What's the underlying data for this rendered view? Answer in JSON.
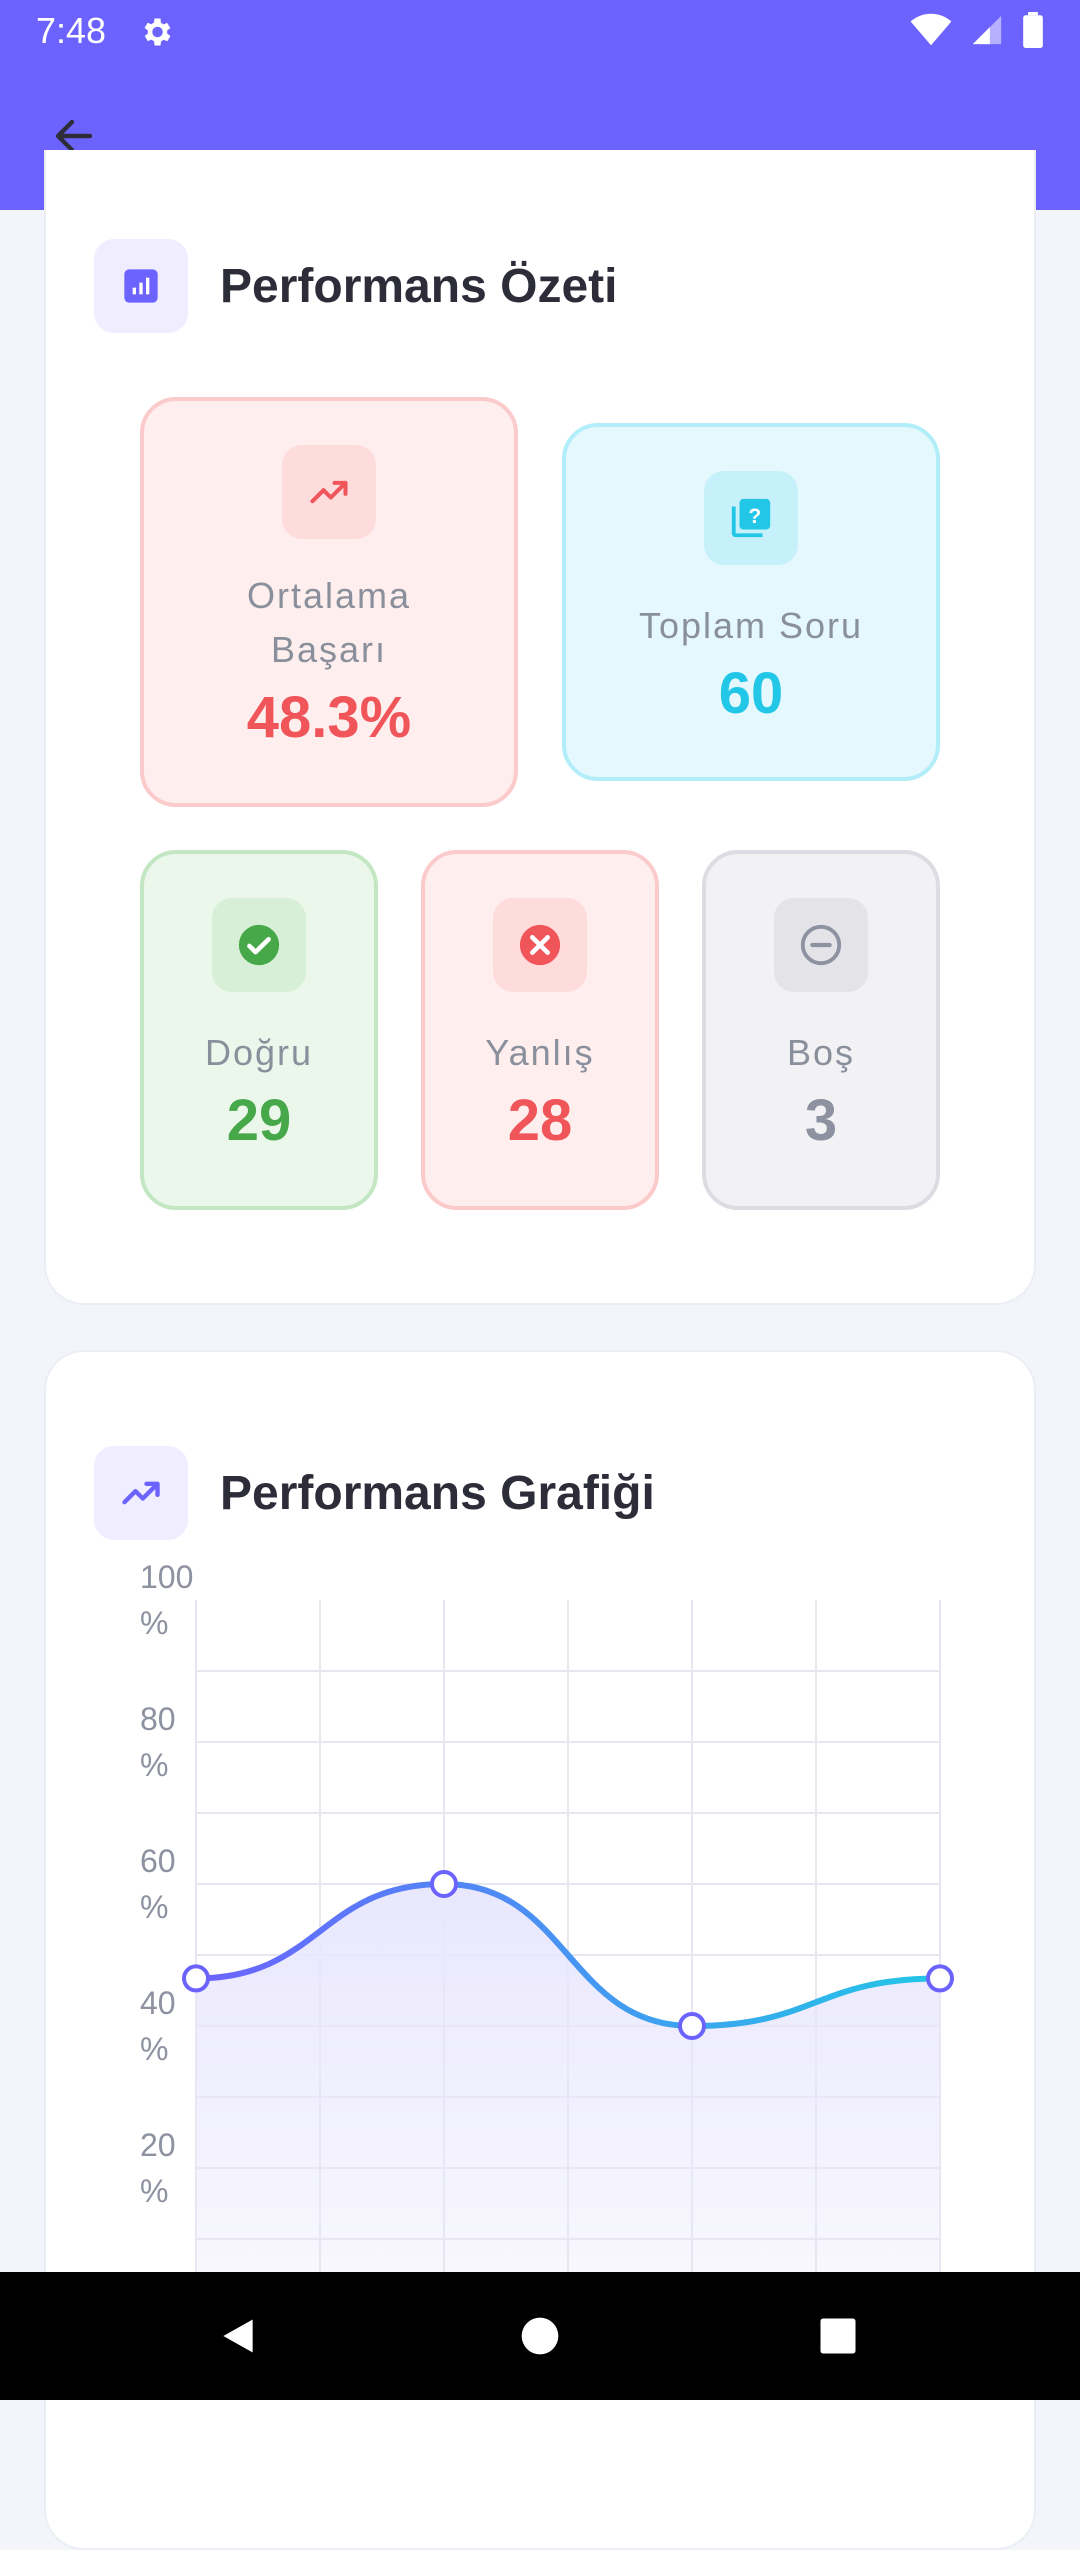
{
  "status_bar": {
    "time": "7:48"
  },
  "summary": {
    "title": "Performans Özeti",
    "average": {
      "label": "Ortalama Başarı",
      "value": "48.3%"
    },
    "total": {
      "label": "Toplam Soru",
      "value": "60"
    },
    "correct": {
      "label": "Doğru",
      "value": "29"
    },
    "wrong": {
      "label": "Yanlış",
      "value": "28"
    },
    "empty": {
      "label": "Boş",
      "value": "3"
    }
  },
  "chart_section": {
    "title": "Performans Grafiği"
  },
  "chart_data": {
    "type": "line",
    "ylim": [
      0,
      100
    ],
    "y_ticks": [
      {
        "value": 100,
        "line1": "100",
        "line2": "%"
      },
      {
        "value": 80,
        "line1": "80",
        "line2": "%"
      },
      {
        "value": 60,
        "line1": "60",
        "line2": "%"
      },
      {
        "value": 40,
        "line1": "40",
        "line2": "%"
      },
      {
        "value": 20,
        "line1": "20",
        "line2": "%"
      }
    ],
    "x": [
      0,
      1,
      2,
      3,
      4,
      5,
      6
    ],
    "series": [
      {
        "values": [
          46.7,
          null,
          60,
          null,
          40,
          null,
          46.7
        ]
      }
    ],
    "grid": true,
    "colors": {
      "line_start": "#6c63ff",
      "line_end": "#22c6e6",
      "fill": "#e9e7fd",
      "marker": "#6c63ff"
    }
  }
}
